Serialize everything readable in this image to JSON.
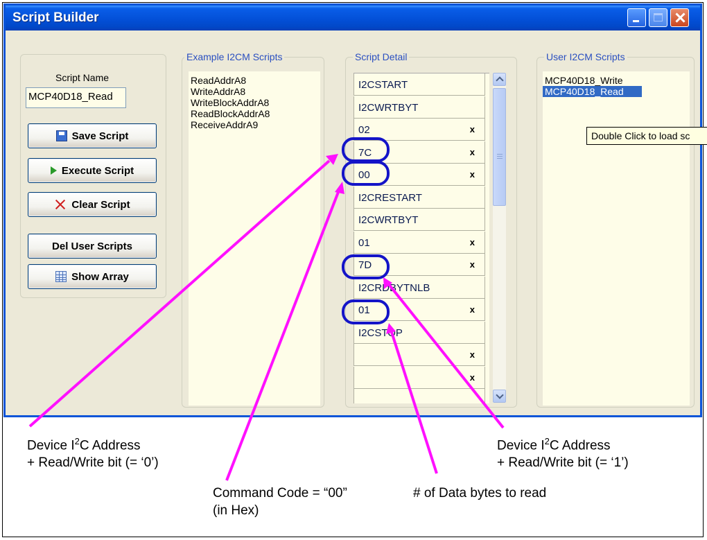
{
  "window": {
    "title": "Script Builder"
  },
  "left_panel": {
    "script_name_label": "Script Name",
    "script_name_value": "MCP40D18_Read",
    "buttons": {
      "save": "Save Script",
      "execute": "Execute Script",
      "clear": "Clear Script",
      "del_user": "Del User Scripts",
      "show_array": "Show Array"
    }
  },
  "example_scripts": {
    "label": "Example I2CM Scripts",
    "items": [
      "ReadAddrA8",
      "WriteAddrA8",
      "WriteBlockAddrA8",
      "ReadBlockAddrA8",
      "ReceiveAddrA9"
    ]
  },
  "script_detail": {
    "label": "Script Detail",
    "delete_symbol": "x",
    "rows": [
      {
        "text": "I2CSTART",
        "deletable": false
      },
      {
        "text": "I2CWRTBYT",
        "deletable": false
      },
      {
        "text": "02",
        "deletable": true
      },
      {
        "text": "7C",
        "deletable": true
      },
      {
        "text": "00",
        "deletable": true
      },
      {
        "text": "I2CRESTART",
        "deletable": false
      },
      {
        "text": "I2CWRTBYT",
        "deletable": false
      },
      {
        "text": "01",
        "deletable": true
      },
      {
        "text": "7D",
        "deletable": true
      },
      {
        "text": "I2CRDBYTNLB",
        "deletable": false
      },
      {
        "text": "01",
        "deletable": true
      },
      {
        "text": "I2CSTOP",
        "deletable": false
      },
      {
        "text": "",
        "deletable": true
      },
      {
        "text": "",
        "deletable": true
      },
      {
        "text": "",
        "deletable": false
      }
    ]
  },
  "user_scripts": {
    "label": "User I2CM Scripts",
    "items": [
      "MCP40D18_Write",
      "MCP40D18_Read"
    ],
    "selected_index": 1,
    "tooltip": "Double Click to load sc"
  },
  "annotations": {
    "addr_write_line1_a": "Device I",
    "addr_write_line1_sup": "2",
    "addr_write_line1_b": "C Address",
    "addr_write_line2": "+ Read/Write bit (= ‘0’)",
    "command_line1": "Command Code = “00”",
    "command_line2": "(in Hex)",
    "data_bytes": "# of Data bytes to read",
    "addr_read_line1_a": "Device I",
    "addr_read_line1_sup": "2",
    "addr_read_line1_b": "C Address",
    "addr_read_line2": "+ Read/Write bit (= ‘1’)",
    "highlight_color": "#1414c8",
    "arrow_color": "#ff10ff"
  }
}
